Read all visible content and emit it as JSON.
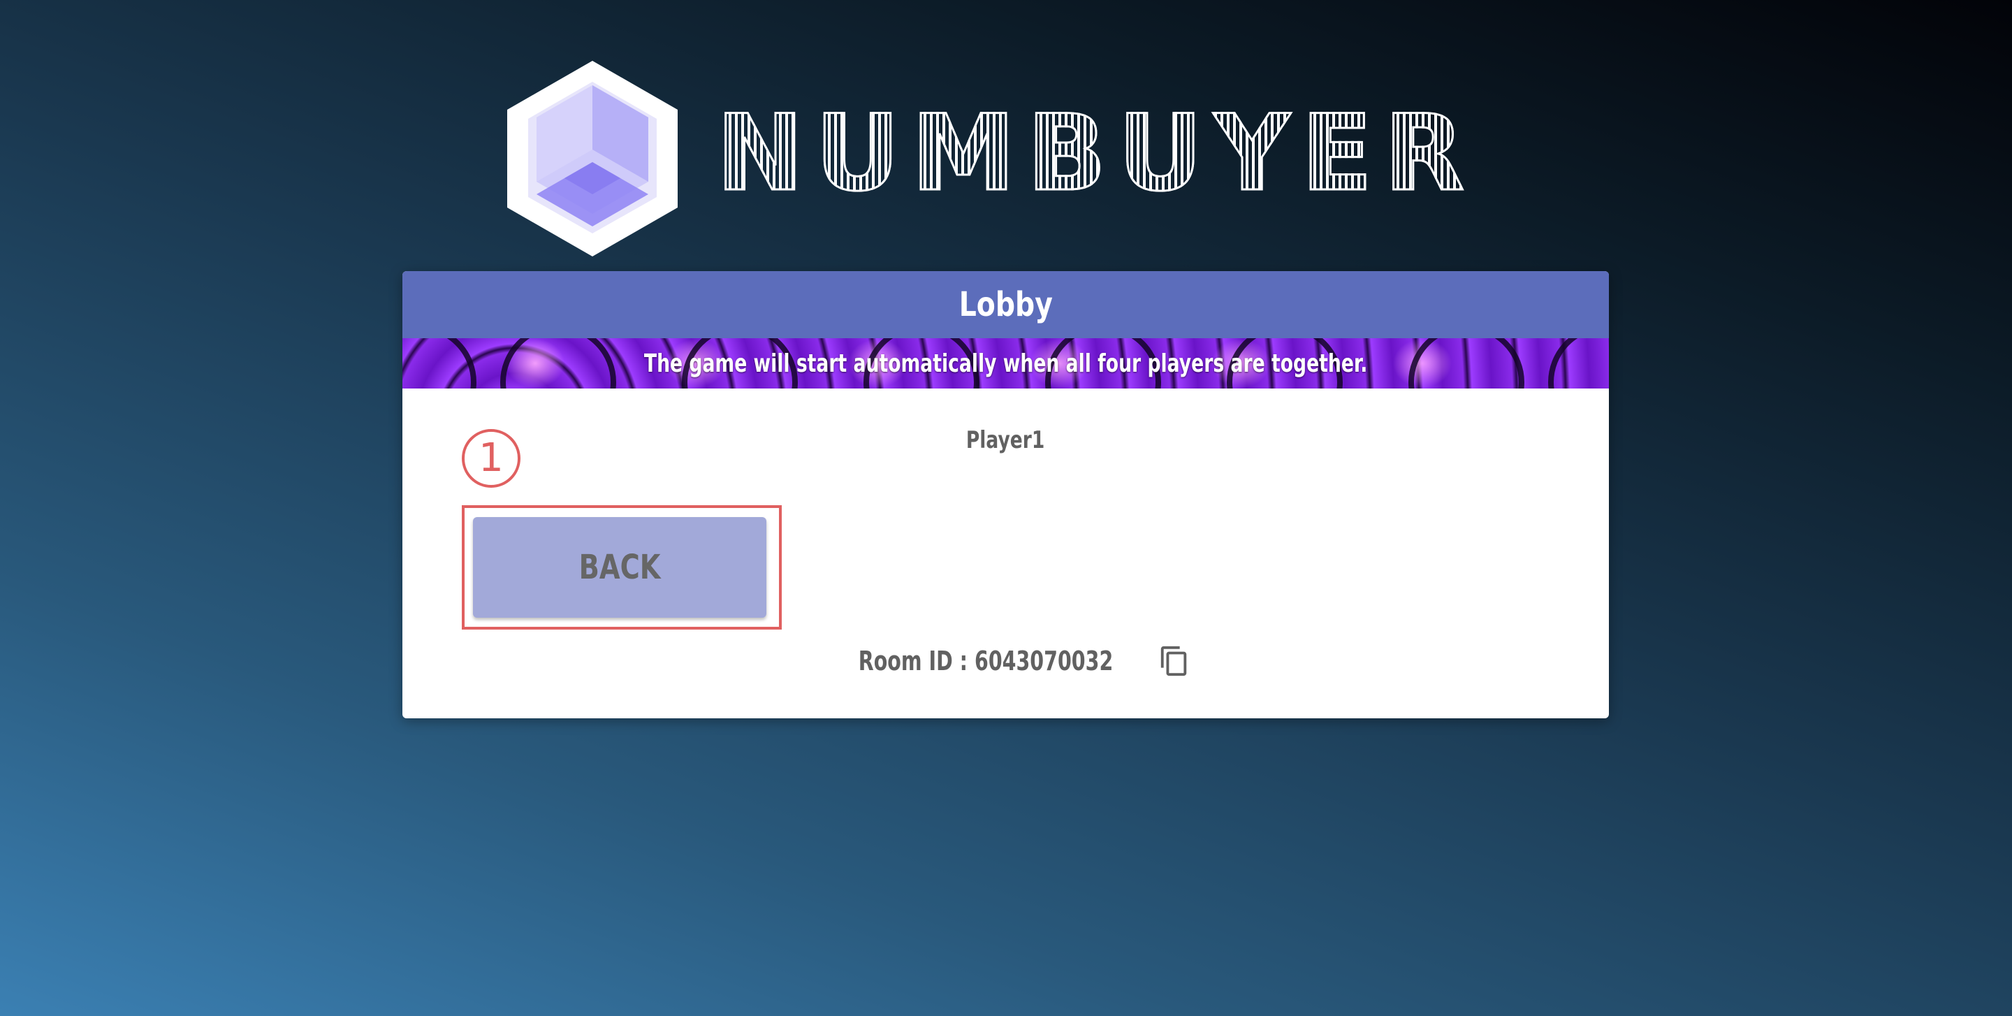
{
  "app": {
    "logo_name": "hexagon-cube-logo",
    "wordmark": [
      "N",
      "U",
      "M",
      "B",
      "U",
      "Y",
      "E",
      "R"
    ]
  },
  "lobby": {
    "title": "Lobby",
    "banner_text": "The game will start automatically when all four players are together.",
    "players": [
      "Player1"
    ],
    "back_label": "BACK",
    "room_id_text": "Room ID : 6043070032",
    "copy_icon": "copy-icon"
  },
  "annotation": {
    "marker_label": "1",
    "color": "#e06060"
  },
  "colors": {
    "header": "#5c6dbb",
    "back_button": "#a2a9d9",
    "text_gray": "#616161"
  }
}
